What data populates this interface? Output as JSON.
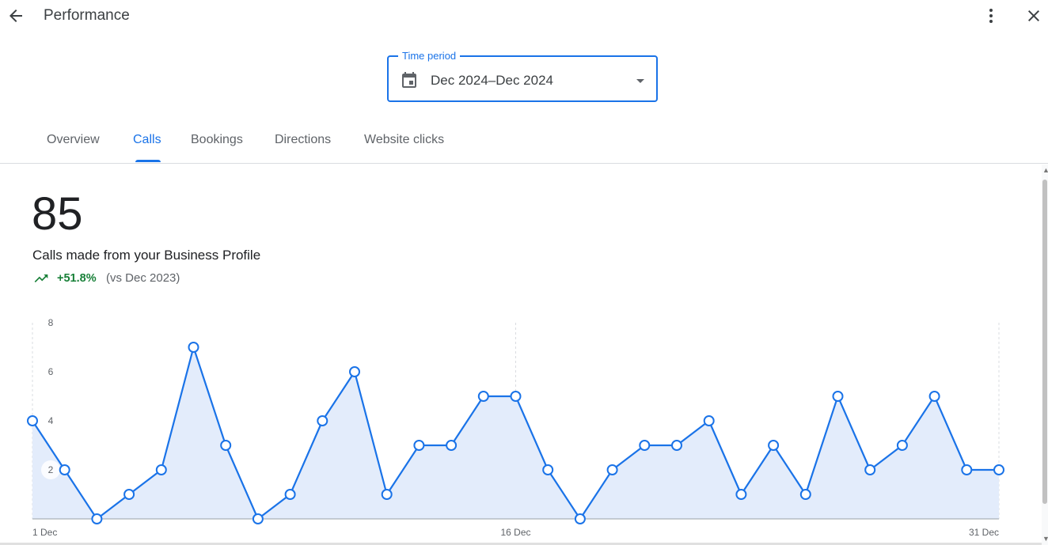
{
  "header": {
    "title": "Performance",
    "back_icon": "arrow-back-icon",
    "more_icon": "more-vert-icon",
    "close_icon": "close-icon"
  },
  "time_period": {
    "label": "Time period",
    "value": "Dec 2024–Dec 2024",
    "icon": "calendar-icon"
  },
  "tabs": [
    {
      "label": "Overview",
      "active": false
    },
    {
      "label": "Calls",
      "active": true
    },
    {
      "label": "Bookings",
      "active": false
    },
    {
      "label": "Directions",
      "active": false
    },
    {
      "label": "Website clicks",
      "active": false
    }
  ],
  "metric": {
    "value": "85",
    "description": "Calls made from your Business Profile",
    "change": "+51.8%",
    "comparison": "(vs Dec 2023)"
  },
  "colors": {
    "accent": "#1a73e8",
    "positive": "#188038",
    "area_fill": "#e3ecfb"
  },
  "chart_data": {
    "type": "area",
    "x": [
      "1 Dec",
      "2 Dec",
      "3 Dec",
      "4 Dec",
      "5 Dec",
      "6 Dec",
      "7 Dec",
      "8 Dec",
      "9 Dec",
      "10 Dec",
      "11 Dec",
      "12 Dec",
      "13 Dec",
      "14 Dec",
      "15 Dec",
      "16 Dec",
      "17 Dec",
      "18 Dec",
      "19 Dec",
      "20 Dec",
      "21 Dec",
      "22 Dec",
      "23 Dec",
      "24 Dec",
      "25 Dec",
      "26 Dec",
      "27 Dec",
      "28 Dec",
      "29 Dec",
      "30 Dec",
      "31 Dec"
    ],
    "series": [
      {
        "values": [
          4,
          2,
          0,
          1,
          2,
          7,
          3,
          0,
          1,
          4,
          6,
          1,
          3,
          3,
          5,
          5,
          2,
          0,
          2,
          3,
          3,
          4,
          1,
          3,
          1,
          5,
          2,
          3,
          5,
          2,
          2
        ]
      }
    ],
    "yticks": [
      "2",
      "4",
      "6",
      "8"
    ],
    "xticks": [
      "1 Dec",
      "16 Dec",
      "31 Dec"
    ],
    "ylim": [
      0,
      8
    ],
    "grid": "vertical-dashed"
  }
}
